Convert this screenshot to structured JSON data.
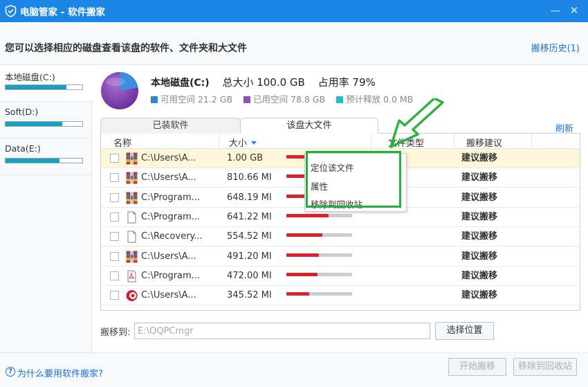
{
  "window": {
    "title": "电脑管家 - 软件搬家",
    "minimize_icon": "—",
    "close_icon": "✕"
  },
  "header": {
    "description": "您可以选择相应的磁盘查看该盘的软件、文件夹和大文件",
    "history_link": "搬移历史(1)"
  },
  "disks": [
    {
      "label": "本地磁盘(C:)",
      "usage": 0.79
    },
    {
      "label": "Soft(D:)",
      "usage": 0.74
    },
    {
      "label": "Data(E:)",
      "usage": 0.7
    }
  ],
  "disk_summary": {
    "name": "本地磁盘(C:)",
    "total": "总大小 100.0 GB",
    "usage": "占用率 79%",
    "free": "可用空间 21.2 GB",
    "used": "已用空间 78.8 GB",
    "release": "预计释放 0.0 MB",
    "colors": {
      "free": "#2b86d6",
      "used": "#8a4fb8",
      "release": "#1ec2c8"
    }
  },
  "tabs": [
    {
      "label": "已装软件"
    },
    {
      "label": "该盘大文件"
    }
  ],
  "refresh_label": "刷新",
  "table": {
    "columns": {
      "name": "名称",
      "size": "大小",
      "type": "文件类型",
      "advice": "搬移建议"
    },
    "rows": [
      {
        "name": "C:\\Users\\A...",
        "size": "1.00 GB",
        "advice": "建议搬移",
        "icon": "archive-icon",
        "bar": 1.0
      },
      {
        "name": "C:\\Users\\A...",
        "size": "810.66 MI",
        "advice": "建议搬移",
        "icon": "archive-icon",
        "bar": 0.81
      },
      {
        "name": "C:\\Program...",
        "size": "648.19 MI",
        "advice": "建议搬移",
        "icon": "archive-icon",
        "bar": 0.65
      },
      {
        "name": "C:\\Program...",
        "size": "641.22 MI",
        "advice": "建议搬移",
        "icon": "file-icon",
        "bar": 0.64
      },
      {
        "name": "C:\\Recovery...",
        "size": "554.52 MI",
        "advice": "建议搬移",
        "icon": "file-icon",
        "bar": 0.55
      },
      {
        "name": "C:\\Users\\A...",
        "size": "491.20 MI",
        "advice": "建议搬移",
        "icon": "archive-icon",
        "bar": 0.49
      },
      {
        "name": "C:\\Program...",
        "size": "472.00 MI",
        "advice": "建议搬移",
        "icon": "pdf-icon",
        "bar": 0.47
      },
      {
        "name": "C:\\Users\\A...",
        "size": "345.52 MI",
        "advice": "建议搬移",
        "icon": "media-icon",
        "bar": 0.35
      }
    ]
  },
  "context_menu": {
    "items": [
      "定位该文件",
      "属性",
      "移除到回收站"
    ]
  },
  "move_to": {
    "label": "搬移到:",
    "path": "E:\\QQPCmgr",
    "choose_button": "选择位置"
  },
  "footer": {
    "help_link": "为什么要用软件搬家?",
    "help_icon": "?",
    "start_button": "开始搬移",
    "recycle_button": "移除到回收站"
  }
}
